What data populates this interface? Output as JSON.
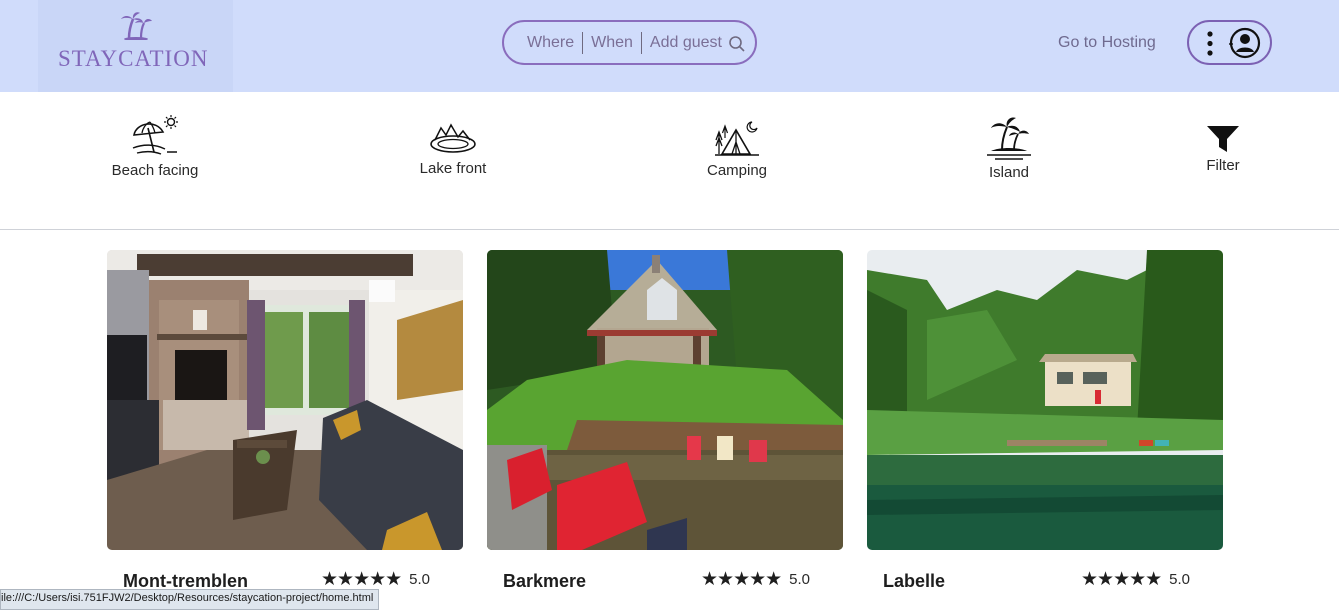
{
  "header": {
    "logo_text": "STAYCATION",
    "search": {
      "where": "Where",
      "when": "When",
      "guest": "Add guest"
    },
    "host_link": "Go to Hosting"
  },
  "categories": [
    {
      "label": "Beach facing",
      "icon": "beach-umbrella-icon"
    },
    {
      "label": "Lake front",
      "icon": "lake-icon"
    },
    {
      "label": "Camping",
      "icon": "tent-icon"
    },
    {
      "label": "Island",
      "icon": "palm-island-icon"
    },
    {
      "label": "Filter",
      "icon": "funnel-icon"
    }
  ],
  "listings": [
    {
      "title": "Mont-tremblen",
      "rating": "5.0",
      "stars": 5
    },
    {
      "title": "Barkmere",
      "rating": "5.0",
      "stars": 5
    },
    {
      "title": "Labelle",
      "rating": "5.0",
      "stars": 5
    }
  ],
  "status_url": "ile:///C:/Users/isi.751FJW2/Desktop/Resources/staycation-project/home.html",
  "colors": {
    "header_bg": "#d0dcfb",
    "accent": "#8066b9"
  }
}
